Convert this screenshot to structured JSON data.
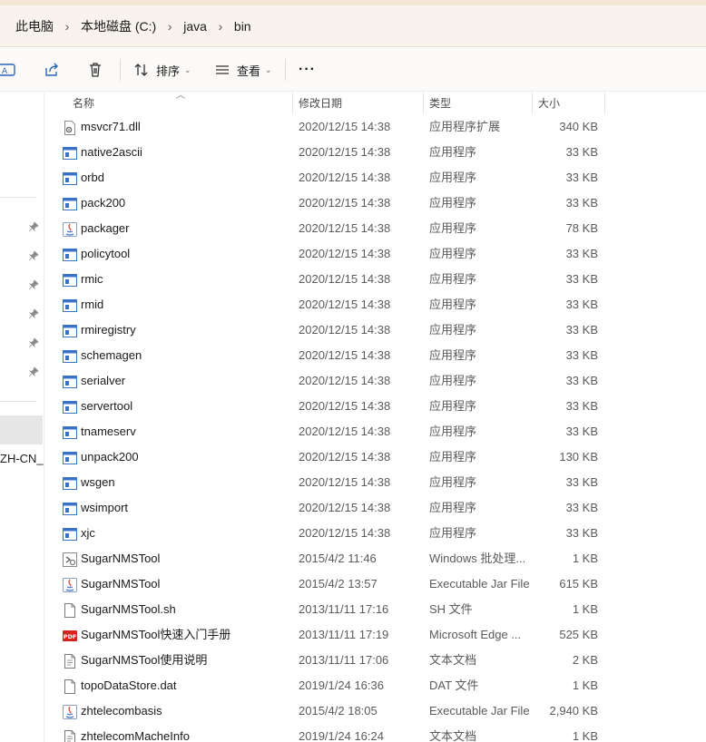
{
  "breadcrumb": [
    "此电脑",
    "本地磁盘 (C:)",
    "java",
    "bin"
  ],
  "toolbar": {
    "sort_label": "排序",
    "view_label": "查看",
    "more_label": "···"
  },
  "sidebar": {
    "truncated_item": "ZH-CN_D"
  },
  "columns": {
    "name": "名称",
    "date": "修改日期",
    "type": "类型",
    "size": "大小"
  },
  "files": [
    {
      "name": "msvcr71.dll",
      "date": "2020/12/15 14:38",
      "type": "应用程序扩展",
      "size": "340 KB",
      "icon": "dll-icon"
    },
    {
      "name": "native2ascii",
      "date": "2020/12/15 14:38",
      "type": "应用程序",
      "size": "33 KB",
      "icon": "exe-icon"
    },
    {
      "name": "orbd",
      "date": "2020/12/15 14:38",
      "type": "应用程序",
      "size": "33 KB",
      "icon": "exe-icon"
    },
    {
      "name": "pack200",
      "date": "2020/12/15 14:38",
      "type": "应用程序",
      "size": "33 KB",
      "icon": "exe-icon"
    },
    {
      "name": "packager",
      "date": "2020/12/15 14:38",
      "type": "应用程序",
      "size": "78 KB",
      "icon": "java-icon"
    },
    {
      "name": "policytool",
      "date": "2020/12/15 14:38",
      "type": "应用程序",
      "size": "33 KB",
      "icon": "exe-icon"
    },
    {
      "name": "rmic",
      "date": "2020/12/15 14:38",
      "type": "应用程序",
      "size": "33 KB",
      "icon": "exe-icon"
    },
    {
      "name": "rmid",
      "date": "2020/12/15 14:38",
      "type": "应用程序",
      "size": "33 KB",
      "icon": "exe-icon"
    },
    {
      "name": "rmiregistry",
      "date": "2020/12/15 14:38",
      "type": "应用程序",
      "size": "33 KB",
      "icon": "exe-icon"
    },
    {
      "name": "schemagen",
      "date": "2020/12/15 14:38",
      "type": "应用程序",
      "size": "33 KB",
      "icon": "exe-icon"
    },
    {
      "name": "serialver",
      "date": "2020/12/15 14:38",
      "type": "应用程序",
      "size": "33 KB",
      "icon": "exe-icon"
    },
    {
      "name": "servertool",
      "date": "2020/12/15 14:38",
      "type": "应用程序",
      "size": "33 KB",
      "icon": "exe-icon"
    },
    {
      "name": "tnameserv",
      "date": "2020/12/15 14:38",
      "type": "应用程序",
      "size": "33 KB",
      "icon": "exe-icon"
    },
    {
      "name": "unpack200",
      "date": "2020/12/15 14:38",
      "type": "应用程序",
      "size": "130 KB",
      "icon": "exe-icon"
    },
    {
      "name": "wsgen",
      "date": "2020/12/15 14:38",
      "type": "应用程序",
      "size": "33 KB",
      "icon": "exe-icon"
    },
    {
      "name": "wsimport",
      "date": "2020/12/15 14:38",
      "type": "应用程序",
      "size": "33 KB",
      "icon": "exe-icon"
    },
    {
      "name": "xjc",
      "date": "2020/12/15 14:38",
      "type": "应用程序",
      "size": "33 KB",
      "icon": "exe-icon"
    },
    {
      "name": "SugarNMSTool",
      "date": "2015/4/2 11:46",
      "type": "Windows 批处理...",
      "size": "1 KB",
      "icon": "batch-icon"
    },
    {
      "name": "SugarNMSTool",
      "date": "2015/4/2 13:57",
      "type": "Executable Jar File",
      "size": "615 KB",
      "icon": "java-icon"
    },
    {
      "name": "SugarNMSTool.sh",
      "date": "2013/11/11 17:16",
      "type": "SH 文件",
      "size": "1 KB",
      "icon": "file-icon"
    },
    {
      "name": "SugarNMSTool快速入门手册",
      "date": "2013/11/11 17:19",
      "type": "Microsoft Edge ...",
      "size": "525 KB",
      "icon": "pdf-icon"
    },
    {
      "name": "SugarNMSTool使用说明",
      "date": "2013/11/11 17:06",
      "type": "文本文档",
      "size": "2 KB",
      "icon": "text-icon"
    },
    {
      "name": "topoDataStore.dat",
      "date": "2019/1/24 16:36",
      "type": "DAT 文件",
      "size": "1 KB",
      "icon": "file-icon"
    },
    {
      "name": "zhtelecombasis",
      "date": "2015/4/2 18:05",
      "type": "Executable Jar File",
      "size": "2,940 KB",
      "icon": "java-icon"
    },
    {
      "name": "zhtelecomMacheInfo",
      "date": "2019/1/24 16:24",
      "type": "文本文档",
      "size": "1 KB",
      "icon": "text-icon"
    }
  ]
}
